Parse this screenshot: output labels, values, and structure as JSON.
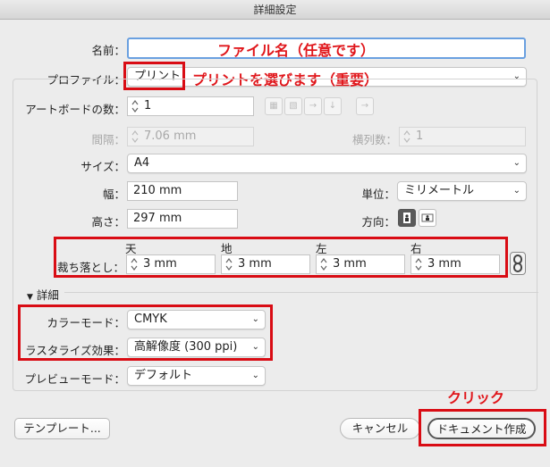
{
  "window": {
    "title": "詳細設定"
  },
  "name_field": {
    "label": "名前：",
    "value": ""
  },
  "profile": {
    "label": "プロファイル：",
    "value": "プリント"
  },
  "artboards": {
    "label": "アートボードの数：",
    "value": "1",
    "spacing_label": "間隔：",
    "spacing_value": "7.06 mm",
    "columns_label": "横列数：",
    "columns_value": "1"
  },
  "size": {
    "label": "サイズ：",
    "value": "A4"
  },
  "width": {
    "label": "幅：",
    "value": "210 mm"
  },
  "height": {
    "label": "高さ：",
    "value": "297 mm"
  },
  "units": {
    "label": "単位：",
    "value": "ミリメートル"
  },
  "orientation": {
    "label": "方向："
  },
  "bleed": {
    "label": "裁ち落とし：",
    "top_label": "天",
    "top_value": "3 mm",
    "bottom_label": "地",
    "bottom_value": "3 mm",
    "left_label": "左",
    "left_value": "3 mm",
    "right_label": "右",
    "right_value": "3 mm"
  },
  "advanced": {
    "label": "詳細"
  },
  "color_mode": {
    "label": "カラーモード：",
    "value": "CMYK"
  },
  "raster": {
    "label": "ラスタライズ効果：",
    "value": "高解像度 (300 ppi)"
  },
  "preview": {
    "label": "プレビューモード：",
    "value": "デフォルト"
  },
  "buttons": {
    "templates": "テンプレート...",
    "cancel": "キャンセル",
    "create": "ドキュメント作成"
  },
  "annotations": {
    "name_note": "ファイル名（任意です）",
    "profile_note": "プリントを選びます（重要）",
    "click_note": "クリック",
    "color": "#e0161b"
  }
}
